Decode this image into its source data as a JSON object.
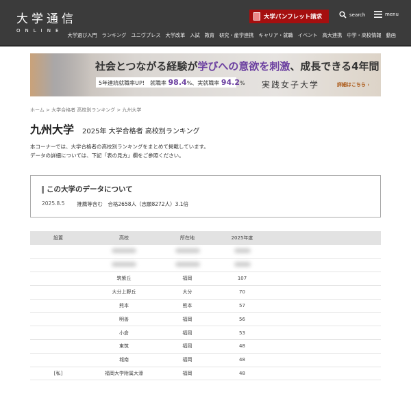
{
  "header": {
    "logo_jp": "大学通信",
    "logo_en": "ONLINE",
    "pamphlet_label": "大学パンフレット請求",
    "search_label": "search",
    "menu_label": "menu",
    "nav": [
      "大学選び入門",
      "ランキング",
      "ユニヴプレス",
      "大学改革",
      "入試",
      "教育",
      "研究・産学連携",
      "キャリア・就職",
      "イベント",
      "高大連携",
      "中学・高校情報",
      "動画"
    ]
  },
  "banner": {
    "headline_a": "社会とつながる経験が",
    "headline_em": "学びへの意欲を刺激",
    "headline_b": "、成長できる4年間",
    "stats_a": "5年連続就職率UP!　就職率",
    "rate1": "98.4",
    "stats_b": "%、実就職率",
    "rate2": "94.2",
    "stats_c": "%",
    "university": "実践女子大学",
    "cta": "詳細はこちら ›"
  },
  "breadcrumb": "ホーム > 大学合格者 高校別ランキング > 九州大学",
  "title": {
    "university": "九州大学",
    "subtitle": "2025年 大学合格者 高校別ランキング"
  },
  "intro": [
    "本コーナーでは、大学合格者の高校別ランキングをまとめて掲載しています。",
    "データの詳細については、下記「表の見方」欄をご参照ください。"
  ],
  "databox": {
    "heading": "この大学のデータについて",
    "date": "2025.8.5",
    "detail": "推薦等含む　合格2658人（志願8272人）3.1倍"
  },
  "table": {
    "headers": [
      "設置",
      "高校",
      "所在地",
      "2025年度"
    ],
    "rows": [
      {
        "type": "",
        "school": "筑紫丘",
        "pref": "福岡",
        "count": "107"
      },
      {
        "type": "",
        "school": "大分上野丘",
        "pref": "大分",
        "count": "70"
      },
      {
        "type": "",
        "school": "熊本",
        "pref": "熊本",
        "count": "57"
      },
      {
        "type": "",
        "school": "明善",
        "pref": "福岡",
        "count": "56"
      },
      {
        "type": "",
        "school": "小倉",
        "pref": "福岡",
        "count": "53"
      },
      {
        "type": "",
        "school": "東筑",
        "pref": "福岡",
        "count": "48"
      },
      {
        "type": "",
        "school": "城南",
        "pref": "福岡",
        "count": "48"
      },
      {
        "type": "[私]",
        "school": "福岡大学附属大濠",
        "pref": "福岡",
        "count": "48"
      }
    ]
  }
}
